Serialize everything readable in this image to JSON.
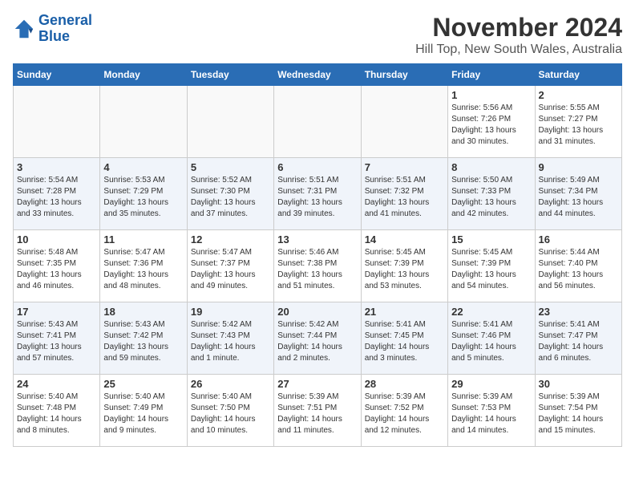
{
  "logo": {
    "line1": "General",
    "line2": "Blue"
  },
  "title": "November 2024",
  "location": "Hill Top, New South Wales, Australia",
  "days_of_week": [
    "Sunday",
    "Monday",
    "Tuesday",
    "Wednesday",
    "Thursday",
    "Friday",
    "Saturday"
  ],
  "weeks": [
    {
      "row_alt": false,
      "days": [
        {
          "num": "",
          "info": ""
        },
        {
          "num": "",
          "info": ""
        },
        {
          "num": "",
          "info": ""
        },
        {
          "num": "",
          "info": ""
        },
        {
          "num": "",
          "info": ""
        },
        {
          "num": "1",
          "info": "Sunrise: 5:56 AM\nSunset: 7:26 PM\nDaylight: 13 hours\nand 30 minutes."
        },
        {
          "num": "2",
          "info": "Sunrise: 5:55 AM\nSunset: 7:27 PM\nDaylight: 13 hours\nand 31 minutes."
        }
      ]
    },
    {
      "row_alt": true,
      "days": [
        {
          "num": "3",
          "info": "Sunrise: 5:54 AM\nSunset: 7:28 PM\nDaylight: 13 hours\nand 33 minutes."
        },
        {
          "num": "4",
          "info": "Sunrise: 5:53 AM\nSunset: 7:29 PM\nDaylight: 13 hours\nand 35 minutes."
        },
        {
          "num": "5",
          "info": "Sunrise: 5:52 AM\nSunset: 7:30 PM\nDaylight: 13 hours\nand 37 minutes."
        },
        {
          "num": "6",
          "info": "Sunrise: 5:51 AM\nSunset: 7:31 PM\nDaylight: 13 hours\nand 39 minutes."
        },
        {
          "num": "7",
          "info": "Sunrise: 5:51 AM\nSunset: 7:32 PM\nDaylight: 13 hours\nand 41 minutes."
        },
        {
          "num": "8",
          "info": "Sunrise: 5:50 AM\nSunset: 7:33 PM\nDaylight: 13 hours\nand 42 minutes."
        },
        {
          "num": "9",
          "info": "Sunrise: 5:49 AM\nSunset: 7:34 PM\nDaylight: 13 hours\nand 44 minutes."
        }
      ]
    },
    {
      "row_alt": false,
      "days": [
        {
          "num": "10",
          "info": "Sunrise: 5:48 AM\nSunset: 7:35 PM\nDaylight: 13 hours\nand 46 minutes."
        },
        {
          "num": "11",
          "info": "Sunrise: 5:47 AM\nSunset: 7:36 PM\nDaylight: 13 hours\nand 48 minutes."
        },
        {
          "num": "12",
          "info": "Sunrise: 5:47 AM\nSunset: 7:37 PM\nDaylight: 13 hours\nand 49 minutes."
        },
        {
          "num": "13",
          "info": "Sunrise: 5:46 AM\nSunset: 7:38 PM\nDaylight: 13 hours\nand 51 minutes."
        },
        {
          "num": "14",
          "info": "Sunrise: 5:45 AM\nSunset: 7:39 PM\nDaylight: 13 hours\nand 53 minutes."
        },
        {
          "num": "15",
          "info": "Sunrise: 5:45 AM\nSunset: 7:39 PM\nDaylight: 13 hours\nand 54 minutes."
        },
        {
          "num": "16",
          "info": "Sunrise: 5:44 AM\nSunset: 7:40 PM\nDaylight: 13 hours\nand 56 minutes."
        }
      ]
    },
    {
      "row_alt": true,
      "days": [
        {
          "num": "17",
          "info": "Sunrise: 5:43 AM\nSunset: 7:41 PM\nDaylight: 13 hours\nand 57 minutes."
        },
        {
          "num": "18",
          "info": "Sunrise: 5:43 AM\nSunset: 7:42 PM\nDaylight: 13 hours\nand 59 minutes."
        },
        {
          "num": "19",
          "info": "Sunrise: 5:42 AM\nSunset: 7:43 PM\nDaylight: 14 hours\nand 1 minute."
        },
        {
          "num": "20",
          "info": "Sunrise: 5:42 AM\nSunset: 7:44 PM\nDaylight: 14 hours\nand 2 minutes."
        },
        {
          "num": "21",
          "info": "Sunrise: 5:41 AM\nSunset: 7:45 PM\nDaylight: 14 hours\nand 3 minutes."
        },
        {
          "num": "22",
          "info": "Sunrise: 5:41 AM\nSunset: 7:46 PM\nDaylight: 14 hours\nand 5 minutes."
        },
        {
          "num": "23",
          "info": "Sunrise: 5:41 AM\nSunset: 7:47 PM\nDaylight: 14 hours\nand 6 minutes."
        }
      ]
    },
    {
      "row_alt": false,
      "days": [
        {
          "num": "24",
          "info": "Sunrise: 5:40 AM\nSunset: 7:48 PM\nDaylight: 14 hours\nand 8 minutes."
        },
        {
          "num": "25",
          "info": "Sunrise: 5:40 AM\nSunset: 7:49 PM\nDaylight: 14 hours\nand 9 minutes."
        },
        {
          "num": "26",
          "info": "Sunrise: 5:40 AM\nSunset: 7:50 PM\nDaylight: 14 hours\nand 10 minutes."
        },
        {
          "num": "27",
          "info": "Sunrise: 5:39 AM\nSunset: 7:51 PM\nDaylight: 14 hours\nand 11 minutes."
        },
        {
          "num": "28",
          "info": "Sunrise: 5:39 AM\nSunset: 7:52 PM\nDaylight: 14 hours\nand 12 minutes."
        },
        {
          "num": "29",
          "info": "Sunrise: 5:39 AM\nSunset: 7:53 PM\nDaylight: 14 hours\nand 14 minutes."
        },
        {
          "num": "30",
          "info": "Sunrise: 5:39 AM\nSunset: 7:54 PM\nDaylight: 14 hours\nand 15 minutes."
        }
      ]
    }
  ]
}
